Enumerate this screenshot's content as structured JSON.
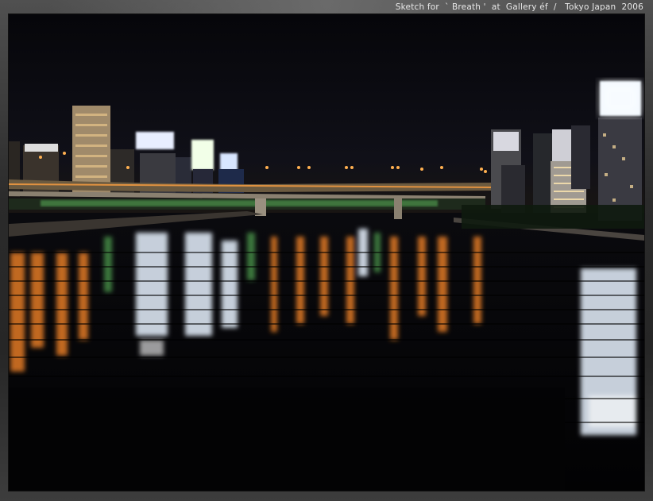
{
  "caption": "Sketch for  ` Breath '  at  Gallery éf  /   Tokyo Japan  2006",
  "photo": {
    "subject": "night river cityscape",
    "alt": ""
  },
  "colors": {
    "sky": "#0b0b10",
    "water": "#040407",
    "light_warm": "#ff8c2a",
    "light_cool": "#e8f2ff",
    "light_green": "#7cff7a"
  }
}
